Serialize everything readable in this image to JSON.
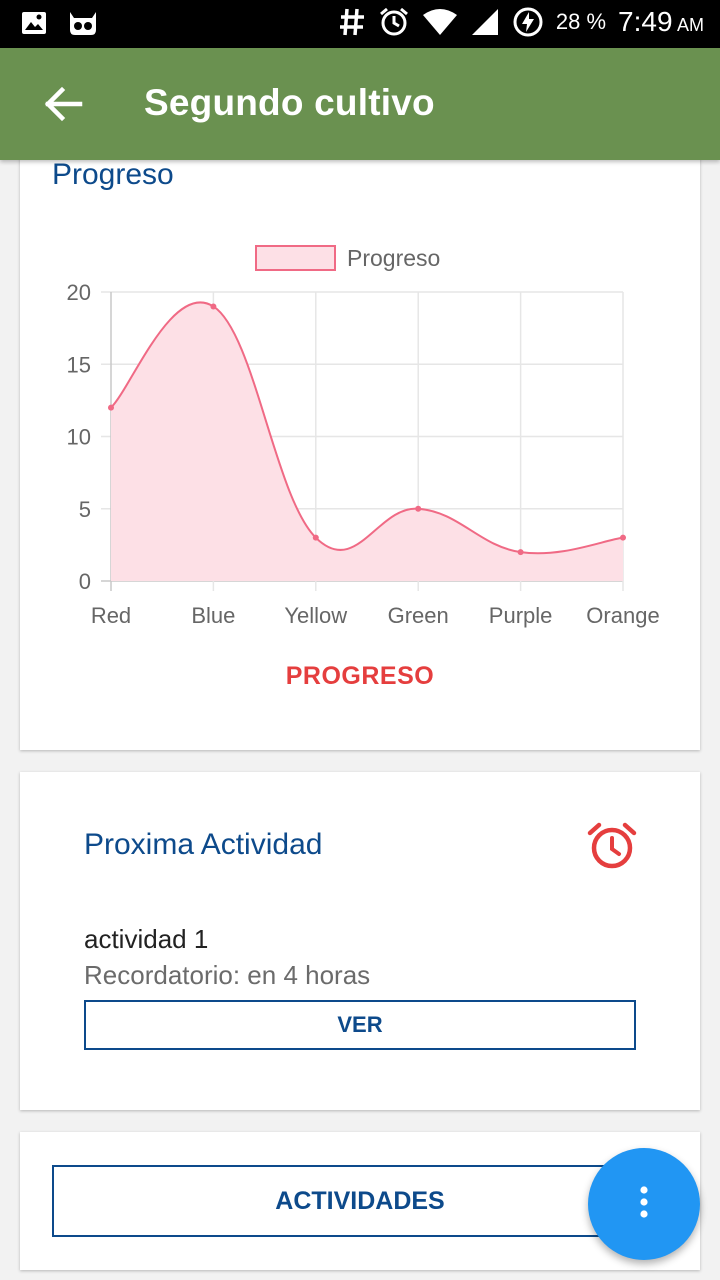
{
  "status_bar": {
    "battery_percent": "28 %",
    "time": "7:49",
    "ampm": "AM",
    "icons": [
      "image-icon",
      "cyanogen-icon",
      "hash-icon",
      "alarm-icon",
      "wifi-icon",
      "signal-icon",
      "battery-charging-icon"
    ]
  },
  "app_bar": {
    "title": "Segundo cultivo",
    "back_icon": "arrow-left-icon",
    "color": "#6a9150"
  },
  "progress_card": {
    "title": "Progreso",
    "link_label": "PROGRESO",
    "link_color": "#e53e3e"
  },
  "chart_data": {
    "type": "area",
    "categories": [
      "Red",
      "Blue",
      "Yellow",
      "Green",
      "Purple",
      "Orange"
    ],
    "series": [
      {
        "name": "Progreso",
        "values": [
          12,
          19,
          3,
          5,
          2,
          3
        ],
        "color": "#f06a85",
        "fill": "#fde0e6"
      }
    ],
    "yticks": [
      "0",
      "5",
      "10",
      "15",
      "20"
    ],
    "ylim": [
      0,
      20
    ],
    "grid": true,
    "legend": "top-center"
  },
  "activity_card": {
    "title": "Proxima Actividad",
    "activity_name": "actividad 1",
    "reminder": "Recordatorio: en 4 horas",
    "button_label": "VER",
    "icon": "alarm-clock-icon",
    "icon_color": "#e53e3e"
  },
  "activities_card": {
    "button_label": "ACTIVIDADES"
  },
  "fab": {
    "icon": "more-vertical-icon",
    "color": "#2196f3"
  }
}
